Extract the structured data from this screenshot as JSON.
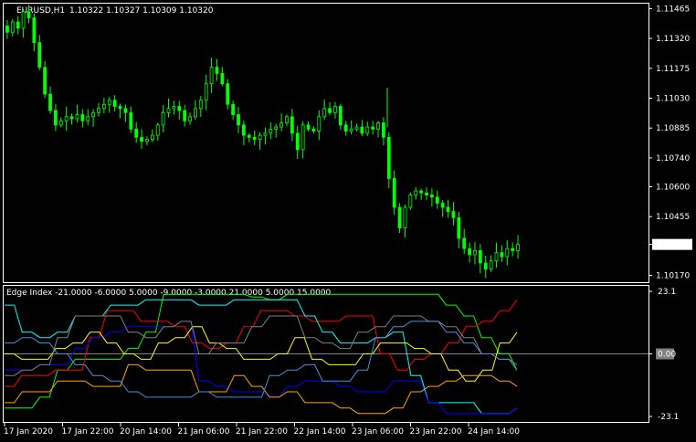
{
  "header": {
    "symbol_tf": "EURUSD,H1",
    "ohlc": "1.10322 1.10327 1.10309 1.10320"
  },
  "indicator": {
    "label": "Edge Index -21.0000 -6.0000 5.0000 -9.0000 -3.0000 21.0000 5.0000 15.0000"
  },
  "colors": {
    "background": "#000000",
    "grid_frame": "#ffffff",
    "candle": "#00ff00",
    "price_tag_bg": "#ffffff",
    "price_tag_text": "#000000",
    "zero_line": "#808080",
    "series_lime": "#00ff00",
    "series_red": "#ff0000",
    "series_cyan": "#00ffff",
    "series_blue": "#0000ff",
    "series_yellow": "#ffff00",
    "series_orange": "#ffa500",
    "series_gray": "#808080",
    "series_steelblue": "#4a90d9"
  },
  "chart_data": [
    {
      "type": "candlestick",
      "title": "EURUSD,H1",
      "y_ticks": [
        "1.11465",
        "1.11320",
        "1.11175",
        "1.11030",
        "1.10885",
        "1.10740",
        "1.10600",
        "1.10455",
        "1.10320",
        "1.10170"
      ],
      "ylim": [
        1.1015,
        1.1148
      ],
      "current_price": "1.10320",
      "close_series": [
        1.1135,
        1.114,
        1.1137,
        1.1145,
        1.1142,
        1.113,
        1.1118,
        1.1105,
        1.1097,
        1.109,
        1.1092,
        1.1094,
        1.1093,
        1.1095,
        1.1092,
        1.1094,
        1.1096,
        1.1098,
        1.11,
        1.1102,
        1.1099,
        1.1098,
        1.1096,
        1.1088,
        1.1084,
        1.1082,
        1.1083,
        1.1085,
        1.109,
        1.1096,
        1.1098,
        1.1099,
        1.1097,
        1.1092,
        1.1094,
        1.1098,
        1.1102,
        1.111,
        1.1118,
        1.1115,
        1.111,
        1.11,
        1.1095,
        1.109,
        1.1085,
        1.1084,
        1.1083,
        1.1085,
        1.1086,
        1.1088,
        1.1089,
        1.1091,
        1.1094,
        1.1086,
        1.1078,
        1.109,
        1.1088,
        1.1087,
        1.1094,
        1.1098,
        1.1096,
        1.1099,
        1.109,
        1.1087,
        1.1088,
        1.1089,
        1.1086,
        1.1089,
        1.1088,
        1.1091,
        1.1084,
        1.1064,
        1.105,
        1.104,
        1.105,
        1.1056,
        1.1058,
        1.1057,
        1.1056,
        1.1055,
        1.1052,
        1.105,
        1.1048,
        1.1045,
        1.1035,
        1.103,
        1.1027,
        1.1029,
        1.1023,
        1.102,
        1.1024,
        1.1028,
        1.1026,
        1.103,
        1.1029,
        1.1032
      ]
    },
    {
      "type": "line",
      "title": "Edge Index -21.0000 -6.0000 5.0000 -9.0000 -3.0000 21.0000 5.0000 15.0000",
      "y_ticks": [
        "23.1",
        "0.00",
        "-23.1"
      ],
      "ylim": [
        -23.1,
        23.1
      ],
      "x_ticks": [
        "17 Jan 2020",
        "17 Jan 22:00",
        "20 Jan 14:00",
        "21 Jan 06:00",
        "21 Jan 22:00",
        "22 Jan 14:00",
        "23 Jan 06:00",
        "23 Jan 22:00",
        "24 Jan 14:00"
      ],
      "series": [
        {
          "color": "#00ff00",
          "values": [
            -20,
            -20,
            -16,
            -6,
            -2,
            -2,
            -2,
            2,
            8,
            22,
            22,
            22,
            22,
            22,
            21,
            20,
            22,
            22,
            22,
            22,
            22,
            22,
            22,
            22,
            22,
            18,
            14,
            6,
            0,
            -6
          ]
        },
        {
          "color": "#ff0000",
          "values": [
            -12,
            -8,
            -8,
            -6,
            -6,
            6,
            16,
            16,
            12,
            12,
            10,
            4,
            2,
            4,
            10,
            16,
            16,
            14,
            12,
            12,
            14,
            14,
            0,
            -6,
            -2,
            0,
            4,
            10,
            12,
            16,
            20
          ]
        },
        {
          "color": "#00ffff",
          "values": [
            18,
            8,
            6,
            8,
            14,
            14,
            18,
            18,
            20,
            20,
            20,
            18,
            18,
            20,
            20,
            20,
            20,
            14,
            8,
            4,
            4,
            6,
            8,
            -8,
            -18,
            -18,
            -18,
            -22,
            -22,
            -20
          ]
        },
        {
          "color": "#0000ff",
          "values": [
            -6,
            -6,
            -4,
            -4,
            2,
            6,
            8,
            10,
            10,
            10,
            12,
            -10,
            -12,
            -14,
            -14,
            -16,
            -12,
            -10,
            -10,
            -12,
            -14,
            -14,
            -10,
            -10,
            -18,
            -22,
            -22,
            -22,
            -22,
            -20
          ]
        },
        {
          "color": "#ffff00",
          "values": [
            0,
            -2,
            -2,
            2,
            4,
            8,
            4,
            0,
            -2,
            4,
            6,
            10,
            4,
            2,
            -2,
            -2,
            0,
            6,
            -2,
            -4,
            -4,
            0,
            4,
            4,
            2,
            0,
            -6,
            -10,
            -6,
            4,
            8
          ]
        },
        {
          "color": "#ffa500",
          "values": [
            -18,
            -14,
            -14,
            -10,
            -10,
            -12,
            -12,
            -4,
            -6,
            -6,
            -6,
            -14,
            -14,
            -8,
            -12,
            -16,
            -14,
            -18,
            -18,
            -20,
            -22,
            -22,
            -20,
            -14,
            -12,
            -10,
            -8,
            -8,
            -10,
            -12
          ]
        },
        {
          "color": "#808080",
          "values": [
            -8,
            -6,
            -4,
            6,
            14,
            14,
            14,
            8,
            6,
            10,
            12,
            0,
            4,
            4,
            10,
            14,
            14,
            6,
            4,
            2,
            8,
            10,
            14,
            14,
            12,
            10,
            6,
            0,
            -2,
            -6
          ]
        },
        {
          "color": "#4a90d9",
          "values": [
            4,
            6,
            4,
            0,
            -4,
            -8,
            -10,
            -14,
            -16,
            -16,
            -16,
            -14,
            -16,
            -16,
            -16,
            -8,
            -6,
            -4,
            -10,
            -10,
            -6,
            6,
            10,
            12,
            12,
            8,
            4,
            0,
            -2,
            -4
          ]
        }
      ]
    }
  ]
}
